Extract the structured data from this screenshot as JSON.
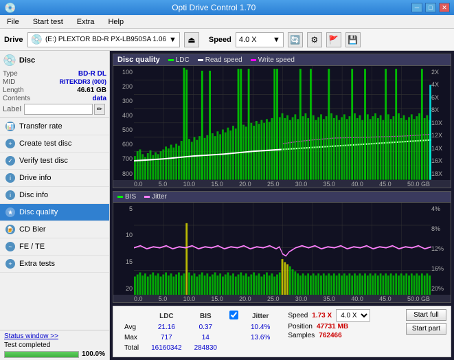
{
  "titlebar": {
    "title": "Opti Drive Control 1.70",
    "minimize": "─",
    "maximize": "□",
    "close": "✕"
  },
  "menubar": {
    "items": [
      "File",
      "Start test",
      "Extra",
      "Help"
    ]
  },
  "toolbar": {
    "drive_label": "Drive",
    "drive_value": "(E:)  PLEXTOR BD-R   PX-LB950SA 1.06",
    "speed_label": "Speed",
    "speed_value": "4.0 X"
  },
  "disc": {
    "title": "Disc",
    "type_label": "Type",
    "type_value": "BD-R DL",
    "mid_label": "MID",
    "mid_value": "RITEKDR3 (000)",
    "length_label": "Length",
    "length_value": "46.61 GB",
    "contents_label": "Contents",
    "contents_value": "data",
    "label_label": "Label",
    "label_value": ""
  },
  "nav": {
    "items": [
      {
        "id": "transfer-rate",
        "label": "Transfer rate",
        "active": false
      },
      {
        "id": "create-test-disc",
        "label": "Create test disc",
        "active": false
      },
      {
        "id": "verify-test-disc",
        "label": "Verify test disc",
        "active": false
      },
      {
        "id": "drive-info",
        "label": "Drive info",
        "active": false
      },
      {
        "id": "disc-info",
        "label": "Disc info",
        "active": false
      },
      {
        "id": "disc-quality",
        "label": "Disc quality",
        "active": true
      },
      {
        "id": "cd-bier",
        "label": "CD Bier",
        "active": false
      },
      {
        "id": "fe-te",
        "label": "FE / TE",
        "active": false
      },
      {
        "id": "extra-tests",
        "label": "Extra tests",
        "active": false
      }
    ]
  },
  "status": {
    "window_btn": "Status window >>",
    "text": "Test completed",
    "progress": 100,
    "progress_label": "100.0%"
  },
  "chart1": {
    "title": "Disc quality",
    "legend": [
      {
        "label": "LDC",
        "color": "#00ff00"
      },
      {
        "label": "Read speed",
        "color": "#ffffff"
      },
      {
        "label": "Write speed",
        "color": "#ff00ff"
      }
    ],
    "y_left": [
      "800",
      "700",
      "600",
      "500",
      "400",
      "300",
      "200",
      "100"
    ],
    "y_right": [
      "18X",
      "16X",
      "14X",
      "12X",
      "10X",
      "8X",
      "6X",
      "4X",
      "2X"
    ],
    "x_labels": [
      "0.0",
      "5.0",
      "10.0",
      "15.0",
      "20.0",
      "25.0",
      "30.0",
      "35.0",
      "40.0",
      "45.0",
      "50.0 GB"
    ]
  },
  "chart2": {
    "legend": [
      {
        "label": "BIS",
        "color": "#00ff00"
      },
      {
        "label": "Jitter",
        "color": "#ff80ff"
      }
    ],
    "y_left": [
      "20",
      "15",
      "10",
      "5"
    ],
    "y_right": [
      "20%",
      "16%",
      "12%",
      "8%",
      "4%"
    ],
    "x_labels": [
      "0.0",
      "5.0",
      "10.0",
      "15.0",
      "20.0",
      "25.0",
      "30.0",
      "35.0",
      "40.0",
      "45.0",
      "50.0 GB"
    ]
  },
  "stats": {
    "ldc_label": "LDC",
    "bis_label": "BIS",
    "jitter_label": "Jitter",
    "jitter_checked": true,
    "speed_label": "Speed",
    "speed_value": "1.73 X",
    "speed_select": "4.0 X",
    "avg_label": "Avg",
    "avg_ldc": "21.16",
    "avg_bis": "0.37",
    "avg_jitter": "10.4%",
    "max_label": "Max",
    "max_ldc": "717",
    "max_bis": "14",
    "max_jitter": "13.6%",
    "position_label": "Position",
    "position_value": "47731 MB",
    "total_label": "Total",
    "total_ldc": "16160342",
    "total_bis": "284830",
    "samples_label": "Samples",
    "samples_value": "762466",
    "start_full": "Start full",
    "start_part": "Start part"
  }
}
